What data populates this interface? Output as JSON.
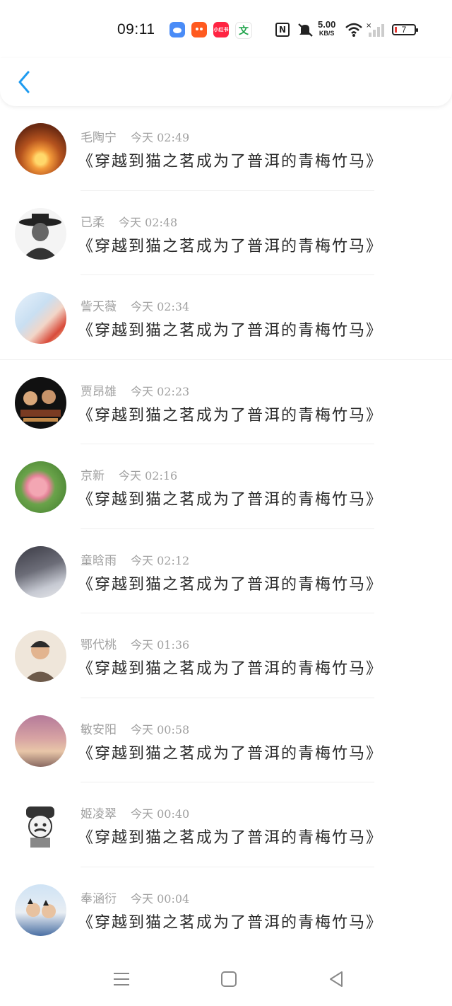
{
  "status_bar": {
    "time": "09:11",
    "net_speed": "5.00",
    "net_unit": "KB/S",
    "battery": "7",
    "app_icons": [
      {
        "name": "cloud-app-icon",
        "color": "#4a8cf7",
        "text": ""
      },
      {
        "name": "taobao-app-icon",
        "color": "#ff5a1f",
        "text": ""
      },
      {
        "name": "xiaohongshu-app-icon",
        "color": "#ff2442",
        "text": "小红书"
      },
      {
        "name": "wen-app-icon",
        "color": "#1ea34a",
        "text": "文"
      }
    ]
  },
  "messages": [
    {
      "user": "毛陶宁",
      "date": "今天 02:49",
      "text": "《穿越到猫之茗成为了普洱的青梅竹马》"
    },
    {
      "user": "已柔",
      "date": "今天 02:48",
      "text": "《穿越到猫之茗成为了普洱的青梅竹马》"
    },
    {
      "user": "訾天薇",
      "date": "今天 02:34",
      "text": "《穿越到猫之茗成为了普洱的青梅竹马》"
    },
    {
      "user": "贾昂雄",
      "date": "今天 02:23",
      "text": "《穿越到猫之茗成为了普洱的青梅竹马》"
    },
    {
      "user": "京新",
      "date": "今天 02:16",
      "text": "《穿越到猫之茗成为了普洱的青梅竹马》"
    },
    {
      "user": "童晗雨",
      "date": "今天 02:12",
      "text": "《穿越到猫之茗成为了普洱的青梅竹马》"
    },
    {
      "user": "鄂代桃",
      "date": "今天 01:36",
      "text": "《穿越到猫之茗成为了普洱的青梅竹马》"
    },
    {
      "user": "敏安阳",
      "date": "今天 00:58",
      "text": "《穿越到猫之茗成为了普洱的青梅竹马》"
    },
    {
      "user": "姬凌翠",
      "date": "今天 00:40",
      "text": "《穿越到猫之茗成为了普洱的青梅竹马》"
    },
    {
      "user": "奉涵衍",
      "date": "今天 00:04",
      "text": "《穿越到猫之茗成为了普洱的青梅竹马》"
    }
  ],
  "colors": {
    "accent": "#1e9bf0",
    "meta_text": "#a0a0a0",
    "title_text": "#2a2a2a"
  }
}
